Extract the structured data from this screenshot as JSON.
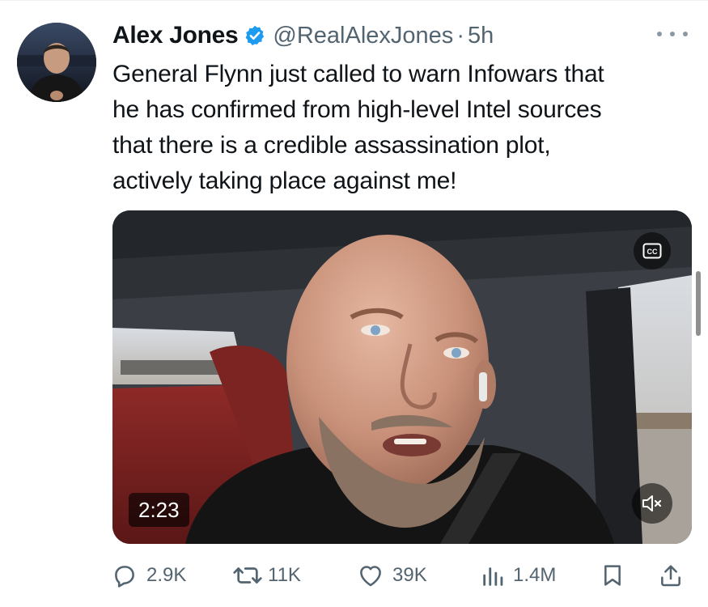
{
  "author": {
    "name": "Alex Jones",
    "handle": "@RealAlexJones",
    "separator": "·",
    "time": "5h",
    "verified_color": "#1d9bf0"
  },
  "tweet": {
    "lines": [
      "General Flynn just called to warn Infowars that",
      "he has confirmed from high-level Intel sources",
      "that there is a credible assassination plot,",
      "actively taking place against me!"
    ]
  },
  "video": {
    "duration": "2:23",
    "captions_icon": "closed-captions-icon",
    "mute_icon": "speaker-muted-icon"
  },
  "actions": {
    "replies": "2.9K",
    "reposts": "11K",
    "likes": "39K",
    "views": "1.4M"
  },
  "colors": {
    "text_primary": "#0f1419",
    "text_secondary": "#536471",
    "accent": "#1d9bf0"
  }
}
